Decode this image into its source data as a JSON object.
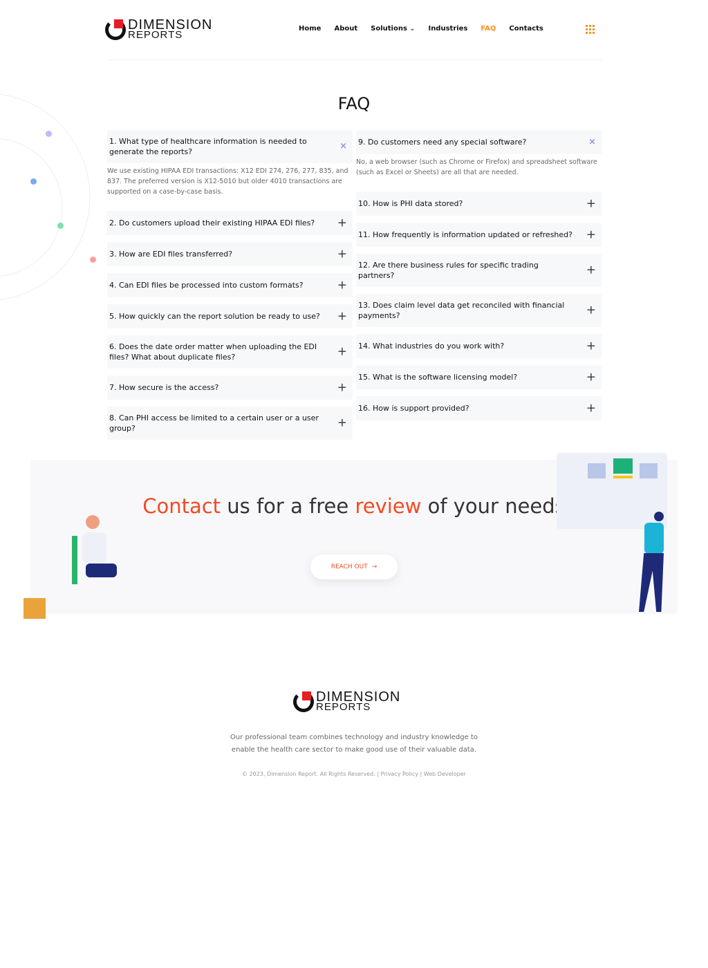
{
  "brand": {
    "line1": "DIMENSION",
    "line2": "REPORTS",
    "accent": "#f04b23"
  },
  "nav": {
    "items": [
      "Home",
      "About",
      "Solutions",
      "Industries",
      "FAQ",
      "Contacts"
    ],
    "active": "FAQ"
  },
  "page_title": "FAQ",
  "faq_left": [
    {
      "q": "1. What type of healthcare information is needed to generate the reports?",
      "a": "We use existing HIPAA EDI transactions: X12 EDI 274, 276, 277, 835, and 837. The preferred version is X12-5010 but older 4010 transactions are supported on a case-by-case basis.",
      "open": true
    },
    {
      "q": "2. Do customers upload their existing HIPAA EDI files?"
    },
    {
      "q": "3. How are EDI files transferred?"
    },
    {
      "q": "4. Can EDI files be processed into custom formats?"
    },
    {
      "q": "5. How quickly can the report solution be ready to use?"
    },
    {
      "q": "6. Does the date order matter when uploading the EDI files? What about duplicate files?"
    },
    {
      "q": "7. How secure is the access?"
    },
    {
      "q": "8. Can PHI access be limited to a certain user or a user group?"
    }
  ],
  "faq_right": [
    {
      "q": "9. Do customers need any special software?",
      "a": "No, a web browser (such as Chrome or Firefox) and spreadsheet software (such as Excel or Sheets) are all that are needed.",
      "open": true
    },
    {
      "q": "10. How is PHI data stored?"
    },
    {
      "q": "11. How frequently is information updated or refreshed?"
    },
    {
      "q": "12. Are there business rules for specific trading partners?"
    },
    {
      "q": "13. Does claim level data get reconciled with financial payments?"
    },
    {
      "q": "14. What industries do you work with?"
    },
    {
      "q": "15. What is the software licensing model?"
    },
    {
      "q": "16. How is support provided?"
    }
  ],
  "cta": {
    "w1": "Contact",
    "w2": " us for a free ",
    "w3": "review",
    "w4": " of your needs",
    "button": "REACH OUT"
  },
  "footer": {
    "about": "Our professional team combines technology and industry knowledge to enable the health care sector to make good use of their valuable data.",
    "copyright": "© 2023, Dimension Report. All Rights Reserved. | Privacy Policy | Web Developer"
  }
}
